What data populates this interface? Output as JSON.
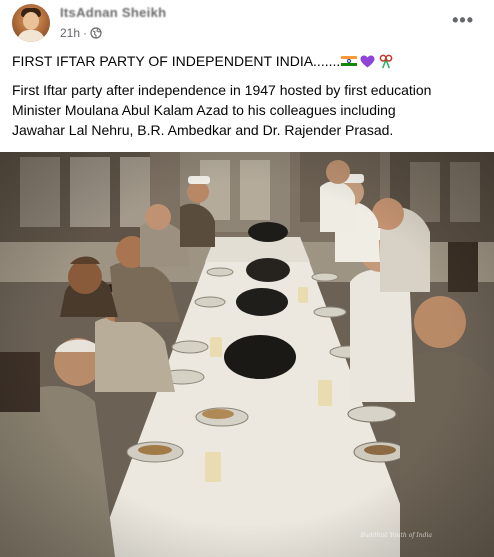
{
  "header": {
    "author_name": "ItsAdnan Sheikh",
    "timestamp": "21h",
    "privacy_icon": "globe-icon",
    "more_icon": "more-options-icon"
  },
  "post": {
    "title": "FIRST IFTAR PARTY OF INDEPENDENT INDIA.......",
    "title_emojis": [
      "india-flag-icon",
      "purple-heart-icon",
      "ribbon-icon"
    ],
    "body_line_1": "First Iftar party after independence in 1947 hosted by first education",
    "body_line_2": "Minister Moulana Abul Kalam Azad to his colleagues including",
    "body_line_3": "Jawahar Lal Nehru, B.R. Ambedkar and Dr. Rajender Prasad."
  },
  "photo": {
    "watermark": "Buddhist Youth of India"
  },
  "colors": {
    "text_primary": "#050505",
    "text_secondary": "#65676b",
    "heart": "#8e44d6",
    "flag_saffron": "#ff9933",
    "flag_green": "#138808"
  }
}
